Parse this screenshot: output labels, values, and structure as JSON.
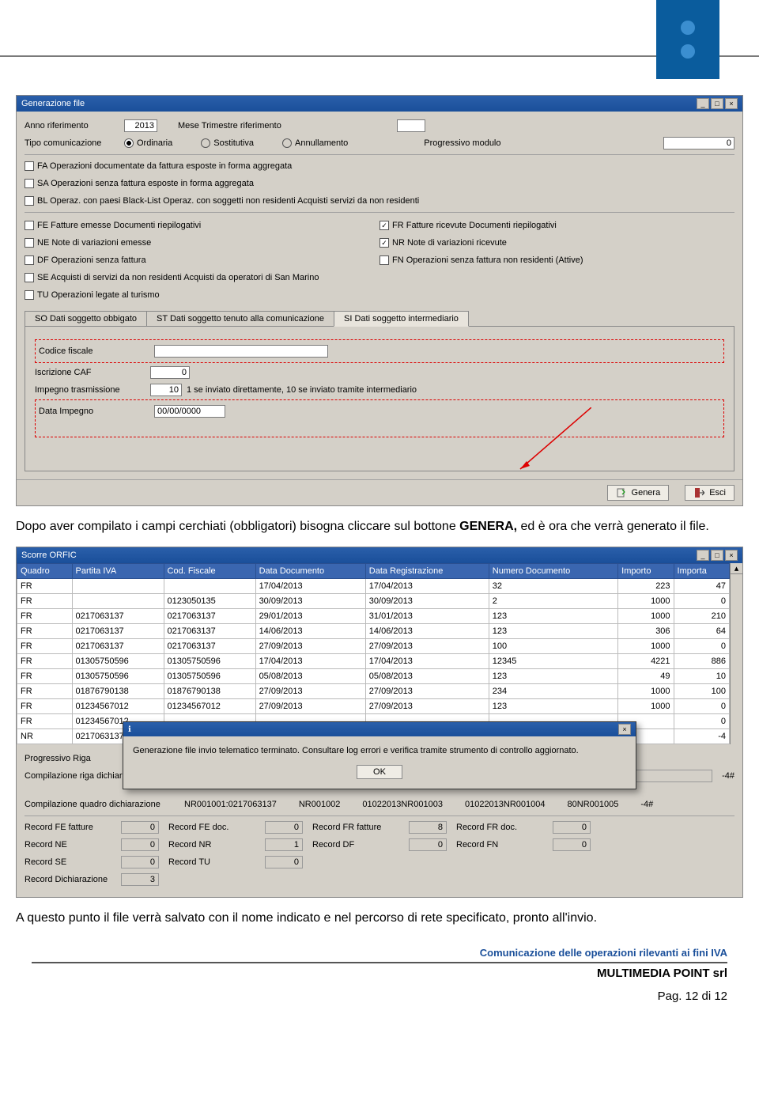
{
  "header_logo": "logo",
  "window1": {
    "title": "Generazione file",
    "anno_label": "Anno riferimento",
    "anno_value": "2013",
    "mese_label": "Mese Trimestre riferimento",
    "tipo_label": "Tipo comunicazione",
    "radio_ordinaria": "Ordinaria",
    "radio_sostitutiva": "Sostitutiva",
    "radio_annullamento": "Annullamento",
    "progressivo_label": "Progressivo modulo",
    "progressivo_value": "0",
    "checks_left": [
      "FA Operazioni documentate da fattura esposte in forma aggregata",
      "SA Operazioni senza fattura esposte in forma aggregata",
      "BL Operaz. con paesi Black-List Operaz. con soggetti non residenti Acquisti servizi da non residenti"
    ],
    "checks_group2": [
      "FE Fatture emesse Documenti riepilogativi",
      "NE Note di variazioni emesse",
      "DF Operazioni senza fattura",
      "SE Acquisti di servizi da non residenti Acquisti da operatori di San Marino",
      "TU Operazioni legate al turismo"
    ],
    "checks_right": [
      {
        "label": "FR Fatture ricevute Documenti riepilogativi",
        "checked": true
      },
      {
        "label": "NR Note di variazioni ricevute",
        "checked": true
      },
      {
        "label": "FN Operazioni senza fattura non residenti (Attive)",
        "checked": false
      }
    ],
    "tabs": {
      "t1": "SO Dati soggetto obbigato",
      "t2": "ST Dati soggetto tenuto alla comunicazione",
      "t3": "SI Dati soggetto intermediario"
    },
    "tab3": {
      "cf_label": "Codice fiscale",
      "iscr_label": "Iscrizione CAF",
      "iscr_value": "0",
      "imp_label": "Impegno trasmissione",
      "imp_value": "10",
      "imp_note": "1 se inviato direttamente, 10 se inviato tramite intermediario",
      "data_label": "Data Impegno",
      "data_value": "00/00/0000"
    },
    "btn_genera": "Genera",
    "btn_esci": "Esci"
  },
  "para1_a": "Dopo aver compilato i campi cerchiati (obbligatori) bisogna cliccare sul bottone ",
  "para1_b": "GENERA, ",
  "para1_c": "ed è ora che verrà generato il file.",
  "window2": {
    "title": "Scorre ORFIC",
    "headers": [
      "Quadro",
      "Partita IVA",
      "Cod. Fiscale",
      "Data Documento",
      "Data Registrazione",
      "Numero Documento",
      "Importo",
      "Importa"
    ],
    "rows": [
      [
        "FR",
        "",
        "",
        "17/04/2013",
        "17/04/2013",
        "32",
        "223",
        "47"
      ],
      [
        "FR",
        "",
        "0123050135",
        "30/09/2013",
        "30/09/2013",
        "2",
        "1000",
        "0"
      ],
      [
        "FR",
        "0217063137",
        "0217063137",
        "29/01/2013",
        "31/01/2013",
        "123",
        "1000",
        "210"
      ],
      [
        "FR",
        "0217063137",
        "0217063137",
        "14/06/2013",
        "14/06/2013",
        "123",
        "306",
        "64"
      ],
      [
        "FR",
        "0217063137",
        "0217063137",
        "27/09/2013",
        "27/09/2013",
        "100",
        "1000",
        "0"
      ],
      [
        "FR",
        "01305750596",
        "01305750596",
        "17/04/2013",
        "17/04/2013",
        "12345",
        "4221",
        "886"
      ],
      [
        "FR",
        "01305750596",
        "01305750596",
        "05/08/2013",
        "05/08/2013",
        "123",
        "49",
        "10"
      ],
      [
        "FR",
        "01876790138",
        "01876790138",
        "27/09/2013",
        "27/09/2013",
        "234",
        "1000",
        "100"
      ],
      [
        "FR",
        "01234567012",
        "01234567012",
        "27/09/2013",
        "27/09/2013",
        "123",
        "1000",
        "0"
      ],
      [
        "FR",
        "01234567012",
        "",
        "",
        "",
        "",
        "",
        "0"
      ],
      [
        "NR",
        "0217063137",
        "",
        "",
        "",
        "",
        "",
        "-4"
      ]
    ],
    "prog_riga": "Progressivo Riga",
    "comp_riga": "Compilazione riga dichiarazione",
    "comp_riga_tail": "-4#",
    "comp_quadro": "Compilazione quadro dichiarazione",
    "comp_quadro_vals": [
      "NR001001:0217063137",
      "NR001002",
      "01022013NR001003",
      "01022013NR001004",
      "80NR001005",
      "-4#"
    ],
    "dialog_msg": "Generazione file invio telematico terminato. Consultare log errori e verifica tramite strumento di controllo aggiornato.",
    "dialog_ok": "OK",
    "summary": {
      "r1": [
        [
          "Record FE fatture",
          "0"
        ],
        [
          "Record FE doc.",
          "0"
        ],
        [
          "Record FR fatture",
          "8"
        ],
        [
          "Record FR doc.",
          "0"
        ]
      ],
      "r2": [
        [
          "Record NE",
          "0"
        ],
        [
          "Record NR",
          "1"
        ],
        [
          "Record DF",
          "0"
        ],
        [
          "Record FN",
          "0"
        ]
      ],
      "r3": [
        [
          "Record SE",
          "0"
        ],
        [
          "Record TU",
          "0"
        ]
      ],
      "r4": [
        [
          "Record Dichiarazione",
          "3"
        ]
      ]
    }
  },
  "para2_a": "A questo punto il file  verrà salvato con il nome indicato e nel percorso di rete specificato, pronto all'invio.",
  "footer": {
    "line1": "Comunicazione delle operazioni rilevanti ai fini IVA",
    "company": "MULTIMEDIA POINT srl",
    "page": "Pag. 12 di 12"
  }
}
